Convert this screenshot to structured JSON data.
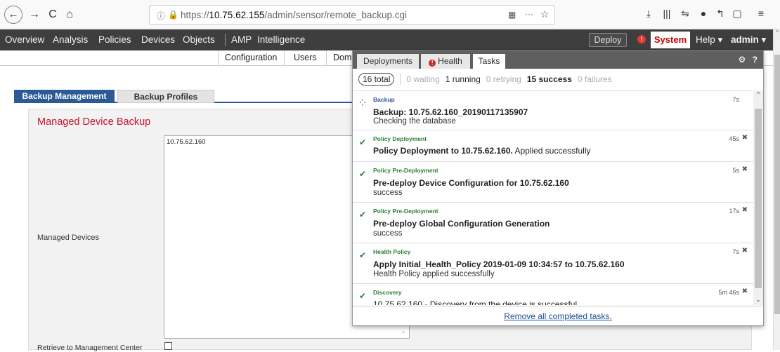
{
  "browser": {
    "url_prefix": "https://",
    "url_host": "10.75.62.155",
    "url_path": "/admin/sensor/remote_backup.cgi",
    "overflow": "···",
    "star": "☆"
  },
  "nav": {
    "items": [
      "Overview",
      "Analysis",
      "Policies",
      "Devices",
      "Objects"
    ],
    "items2": [
      "AMP",
      "Intelligence"
    ],
    "deploy": "Deploy",
    "alert": "!",
    "system": "System",
    "help": "Help ▾",
    "user": "admin ▾"
  },
  "subnav": {
    "configuration": "Configuration",
    "users": "Users",
    "dom": "Dom"
  },
  "tabs": {
    "backup_management": "Backup Management",
    "backup_profiles": "Backup Profiles"
  },
  "main": {
    "title": "Managed Device Backup",
    "device_entry": "10.75.62.160",
    "managed_devices_label": "Managed Devices",
    "retrieve_label": "Retrieve to Management Center"
  },
  "panel": {
    "tab_deployments": "Deployments",
    "tab_health": "Health",
    "tab_tasks": "Tasks",
    "health_badge": "!",
    "gear": "⚙",
    "help": "?",
    "total": "16 total",
    "waiting": "0 waiting",
    "running": "1 running",
    "retrying": "0 retrying",
    "success": "15 success",
    "failures": "0 failures",
    "footer_link": "Remove all completed tasks.",
    "tasks": [
      {
        "category": "Backup",
        "title": "Backup: 10.75.62.160_20190117135907",
        "message": "Checking the database",
        "time": "7s",
        "status": "running"
      },
      {
        "category": "Policy Deployment",
        "title": "Policy Deployment to 10.75.62.160.",
        "title_suffix": " Applied successfully",
        "message": "",
        "time": "45s",
        "status": "success"
      },
      {
        "category": "Policy Pre-Deployment",
        "title": "Pre-deploy Device Configuration for 10.75.62.160",
        "message": "success",
        "time": "5s",
        "status": "success"
      },
      {
        "category": "Policy Pre-Deployment",
        "title": "Pre-deploy Global Configuration Generation",
        "message": "success",
        "time": "17s",
        "status": "success"
      },
      {
        "category": "Health Policy",
        "title": "Apply Initial_Health_Policy 2019-01-09 10:34:57 to 10.75.62.160",
        "message": "Health Policy applied successfully",
        "time": "7s",
        "status": "success"
      },
      {
        "category": "Discovery",
        "title": "10.75.62.160 - Discovery from the device is successful.",
        "message": "",
        "time": "5m 46s",
        "status": "success"
      }
    ]
  }
}
